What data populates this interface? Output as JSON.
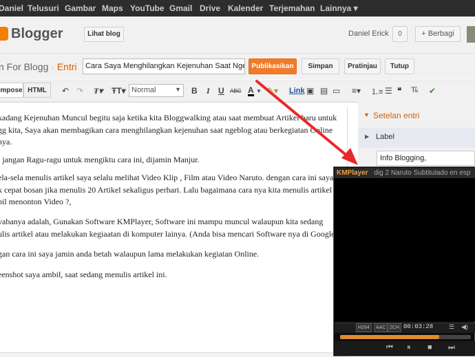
{
  "google_bar": {
    "items": [
      "Daniel",
      "Telusuri",
      "Gambar",
      "Maps",
      "YouTube",
      "Gmail",
      "Drive",
      "Kalender",
      "Terjemahan",
      "Lainnya ▾"
    ]
  },
  "header": {
    "logo_text": "Blogger",
    "view_blog": "Lihat blog",
    "user_name": "Daniel Erick",
    "notif_count": "0",
    "share": "+ Berbagi"
  },
  "post": {
    "blog_name": "n For Blogg",
    "sep": "·",
    "mode": "Entri",
    "title": "Cara Saya Menghilangkan Kejenuhan Saat Ngeblog",
    "publish": "Publikasikan",
    "save": "Simpan",
    "preview": "Pratinjau",
    "close": "Tutup"
  },
  "toolbar": {
    "compose": "mpose",
    "html": "HTML",
    "format": "Normal",
    "link": "Link"
  },
  "content": {
    "p1": [
      "kadang Kejenuhan Muncul begitu saja ketika kita Bloggwalking atau saat membuat Artikel baru untuk",
      "gg kita, Saya akan membagikan cara menghilangkan kejenuhan saat ngeblog atau berkegiatan Online",
      "nya."
    ],
    "p2": "i jangan Ragu-ragu untuk mengiktu cara ini, dijamin Manjur.",
    "p3": [
      "ela-sela menulis artikel saya selalu melihat Video Klip , Film atau Video Naruto. dengan cara ini saya",
      "k cepat bosan jika menulis 20 Artikel sekaligus perhari. Lalu bagaimana cara nya kita menulis artikel",
      "bil menonton Video ?,"
    ],
    "p4": [
      "vabanya adalah, Gunakan Software KMPlayer, Software ini mampu muncul walaupun kita sedang",
      "ulis artikel atau melakukan kegiaatan di komputer lainya.  (Anda bisa mencari Software nya di Google)."
    ],
    "p5": "gan cara ini saya jamin anda betah walaupun lama melakukan kegiatan Online.",
    "p6": "eenshot saya ambil, saat sedang menulis artikel ini."
  },
  "sidebar": {
    "settings_title": "Setelan entri",
    "label_title": "Label",
    "label_value": "Info Blogging,"
  },
  "kmplayer": {
    "title": "KMPlayer",
    "file": "dig 2 Naruto Subtitulado en esp",
    "time": "00:03:28",
    "seek_progress": 0.76,
    "chips": [
      "H264",
      "AAC",
      "2CH"
    ]
  },
  "colors": {
    "accent": "#f27a28",
    "arrow": "#e8282b",
    "google_bar": "#2d2d2d"
  }
}
